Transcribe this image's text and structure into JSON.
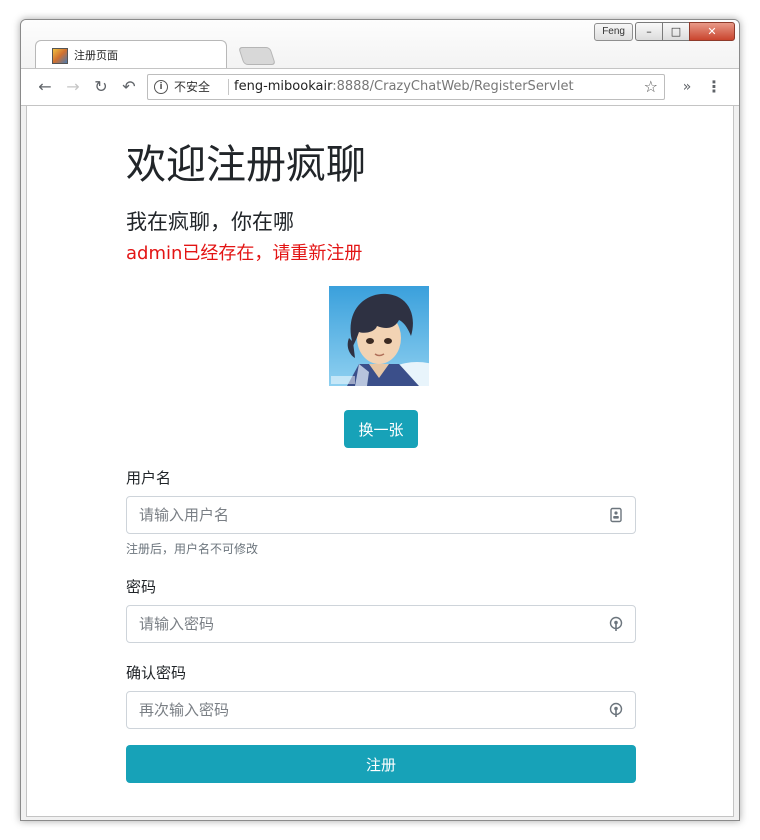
{
  "browser": {
    "profile_name": "Feng",
    "tab": {
      "title": "注册页面",
      "favicon": "page-favicon-icon"
    },
    "window_controls": [
      "minimize-icon",
      "maximize-icon",
      "close-icon"
    ],
    "nav": {
      "back": "back-arrow-icon",
      "forward": "forward-arrow-icon",
      "reload": "reload-icon",
      "undo": "undo-icon"
    },
    "address_bar": {
      "security_label": "不安全",
      "url_host": "feng-mibookair",
      "url_path": ":8888/CrazyChatWeb/RegisterServlet"
    },
    "menu_icons": [
      "bookmark-star-icon",
      "extensions-chevron-icon",
      "kebab-menu-icon"
    ]
  },
  "page": {
    "title": "欢迎注册疯聊",
    "slogan": "我在疯聊，你在哪",
    "error_message": "admin已经存在，请重新注册",
    "avatar_alt": "avatar",
    "change_avatar_label": "换一张",
    "form": {
      "username": {
        "label": "用户名",
        "placeholder": "请输入用户名",
        "value": "",
        "help": "注册后，用户名不可修改",
        "icon": "id-card-icon"
      },
      "password": {
        "label": "密码",
        "placeholder": "请输入密码",
        "value": "",
        "icon": "key-icon"
      },
      "confirm_password": {
        "label": "确认密码",
        "placeholder": "再次输入密码",
        "value": "",
        "icon": "key-icon"
      },
      "submit_label": "注册"
    }
  },
  "colors": {
    "accent": "#17a2b8",
    "error": "#e31414",
    "text": "#212529"
  }
}
